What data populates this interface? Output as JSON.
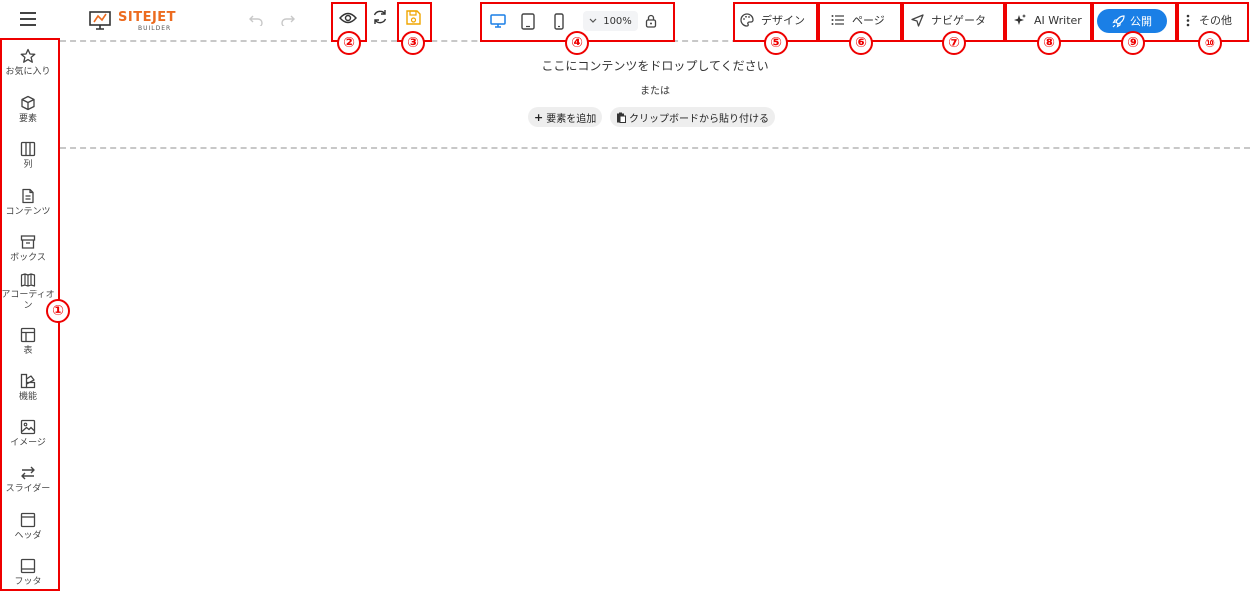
{
  "app": {
    "logo_text": "SITEJET",
    "logo_sub": "BUILDER"
  },
  "toolbar": {
    "zoom": "100%",
    "design": "デザイン",
    "pages": "ページ",
    "navigator": "ナビゲータ",
    "ai_writer": "AI Writer",
    "publish": "公開",
    "more": "その他"
  },
  "sidebar": {
    "items": [
      {
        "label": "お気に入り",
        "icon": "star-icon"
      },
      {
        "label": "要素",
        "icon": "cube-icon"
      },
      {
        "label": "列",
        "icon": "columns-icon"
      },
      {
        "label": "コンテンツ",
        "icon": "document-icon"
      },
      {
        "label": "ボックス",
        "icon": "box-icon"
      },
      {
        "label": "アコーディオン",
        "icon": "accordion-icon"
      },
      {
        "label": "表",
        "icon": "table-icon"
      },
      {
        "label": "機能",
        "icon": "shapes-icon"
      },
      {
        "label": "イメージ",
        "icon": "image-icon"
      },
      {
        "label": "スライダー",
        "icon": "slider-icon"
      },
      {
        "label": "ヘッダ",
        "icon": "header-icon"
      },
      {
        "label": "フッタ",
        "icon": "footer-icon"
      }
    ]
  },
  "canvas": {
    "drop_title": "ここにコンテンツをドロップしてください",
    "or": "または",
    "add_element": "要素を追加",
    "paste": "クリップボードから貼り付ける"
  },
  "annotations": [
    "①",
    "②",
    "③",
    "④",
    "⑤",
    "⑥",
    "⑦",
    "⑧",
    "⑨",
    "⑩"
  ],
  "colors": {
    "brand": "#ec6b1f",
    "primary": "#1a7fe6",
    "annotation": "#e00000",
    "save": "#f0a500"
  }
}
